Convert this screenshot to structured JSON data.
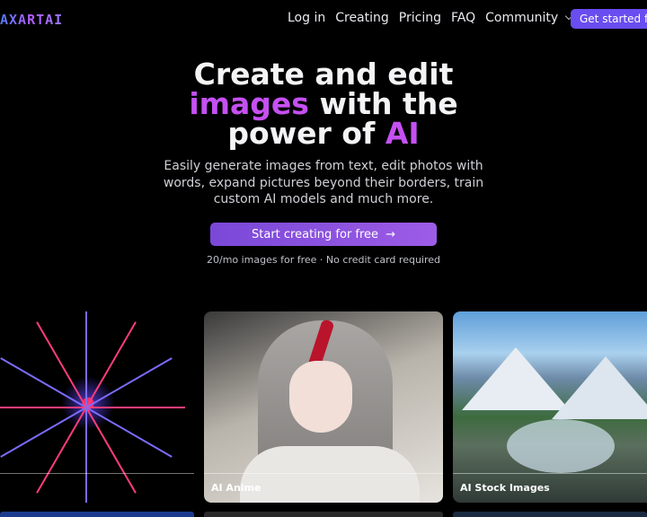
{
  "header": {
    "logo_text": "AXARTAI",
    "nav": {
      "login": "Log in",
      "creating": "Creating",
      "pricing": "Pricing",
      "faq": "FAQ",
      "community": "Community"
    },
    "cta_label": "Get started for"
  },
  "hero": {
    "title_line1": "Create and edit",
    "title_line2_accent": "images",
    "title_line2_rest": " with the",
    "title_line3_rest": "power of ",
    "title_line3_accent": "AI",
    "subtitle": "Easily generate images from text, edit photos with words, expand pictures beyond their borders, train custom AI models and much more.",
    "cta_label": "Start creating for free",
    "cta_icon": "arrow-right-icon",
    "note": "20/mo images for free · No credit card required"
  },
  "gallery": {
    "cards": [
      {
        "label": ""
      },
      {
        "label": "AI Anime"
      },
      {
        "label": "AI Stock Images"
      }
    ]
  },
  "colors": {
    "accent": "#c550f2",
    "button": "#6a4df0"
  }
}
